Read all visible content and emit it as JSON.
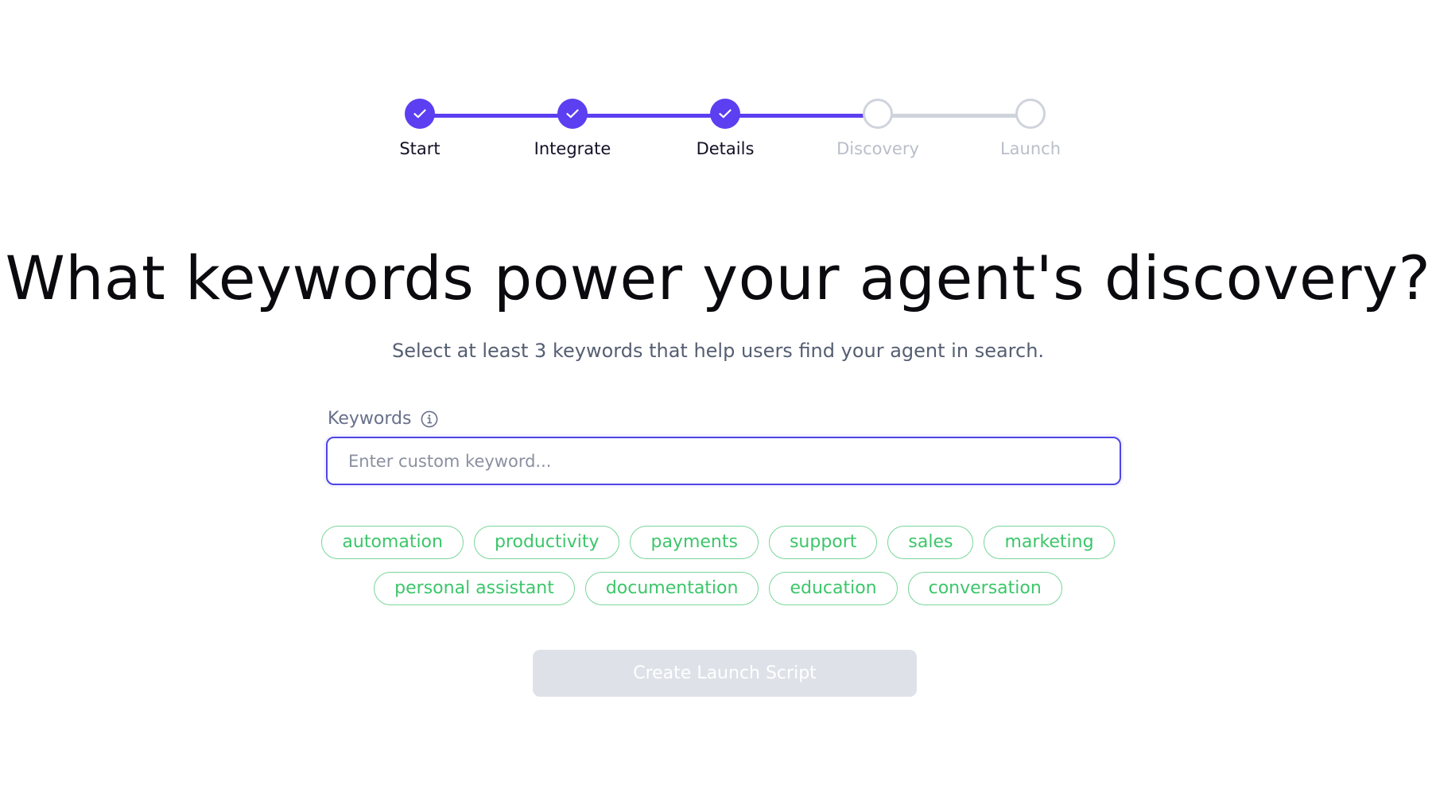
{
  "stepper": {
    "steps": [
      {
        "label": "Start",
        "state": "completed"
      },
      {
        "label": "Integrate",
        "state": "completed"
      },
      {
        "label": "Details",
        "state": "completed"
      },
      {
        "label": "Discovery",
        "state": "pending"
      },
      {
        "label": "Launch",
        "state": "pending"
      }
    ],
    "completed_icon": "check-icon"
  },
  "heading": {
    "title": "What keywords power your agent's discovery?",
    "subtitle": "Select at least 3 keywords that help users find your agent in search."
  },
  "keywords_field": {
    "label": "Keywords",
    "info_icon": "info-icon",
    "placeholder": "Enter custom keyword...",
    "value": ""
  },
  "suggestions": {
    "row1": [
      "automation",
      "productivity",
      "payments",
      "support",
      "sales",
      "marketing"
    ],
    "row2": [
      "personal assistant",
      "documentation",
      "education",
      "conversation"
    ]
  },
  "actions": {
    "create_label": "Create Launch Script",
    "create_enabled": false
  },
  "colors": {
    "accent": "#5b3ff0",
    "input_border": "#4f45e4",
    "chip_green": "#3cc66a",
    "pending_gray": "#cfd3dc",
    "disabled_button": "#dee2e8"
  }
}
